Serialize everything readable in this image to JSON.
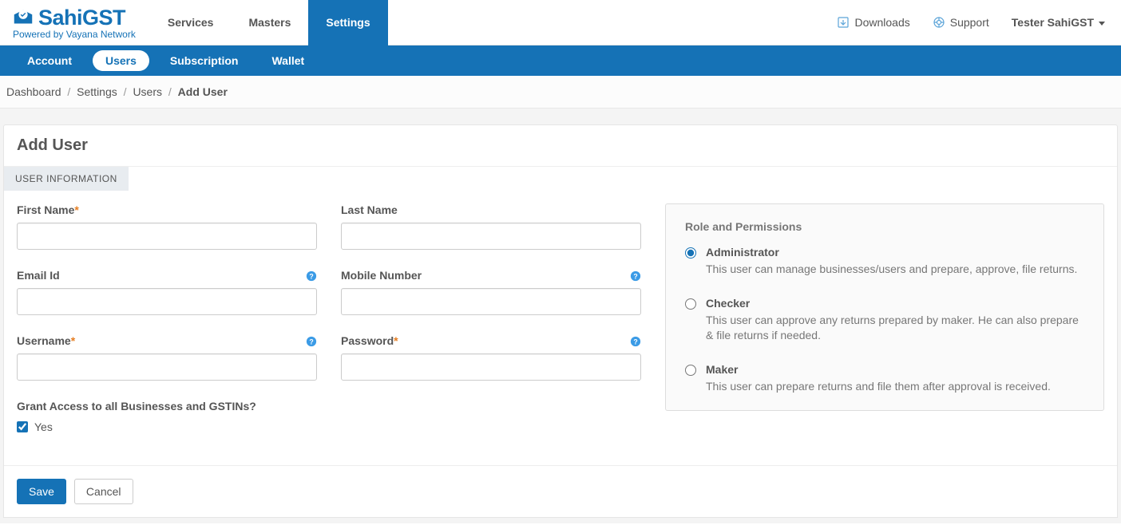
{
  "brand": {
    "name": "SahiGST",
    "tagline": "Powered by Vayana Network"
  },
  "top_nav": {
    "items": [
      {
        "label": "Services"
      },
      {
        "label": "Masters"
      },
      {
        "label": "Settings"
      }
    ],
    "right": {
      "downloads": "Downloads",
      "support": "Support",
      "user": "Tester SahiGST"
    }
  },
  "sub_nav": {
    "items": [
      {
        "label": "Account"
      },
      {
        "label": "Users"
      },
      {
        "label": "Subscription"
      },
      {
        "label": "Wallet"
      }
    ]
  },
  "breadcrumb": {
    "items": [
      "Dashboard",
      "Settings",
      "Users"
    ],
    "current": "Add User"
  },
  "page": {
    "title": "Add User",
    "tab": "USER INFORMATION"
  },
  "form": {
    "first_name": {
      "label": "First Name",
      "required": true
    },
    "last_name": {
      "label": "Last Name",
      "required": false
    },
    "email": {
      "label": "Email Id",
      "required": false,
      "help": true
    },
    "mobile": {
      "label": "Mobile Number",
      "required": false,
      "help": true
    },
    "username": {
      "label": "Username",
      "required": true,
      "help": true
    },
    "password": {
      "label": "Password",
      "required": true,
      "help": true
    },
    "grant": {
      "label": "Grant Access to all Businesses and GSTINs?",
      "option": "Yes",
      "checked": true
    }
  },
  "roles": {
    "title": "Role and Permissions",
    "options": [
      {
        "name": "Administrator",
        "desc": "This user can manage businesses/users and prepare, approve, file returns.",
        "selected": true
      },
      {
        "name": "Checker",
        "desc": "This user can approve any returns prepared by maker. He can also prepare & file returns if needed.",
        "selected": false
      },
      {
        "name": "Maker",
        "desc": "This user can prepare returns and file them after approval is received.",
        "selected": false
      }
    ]
  },
  "actions": {
    "save": "Save",
    "cancel": "Cancel"
  }
}
